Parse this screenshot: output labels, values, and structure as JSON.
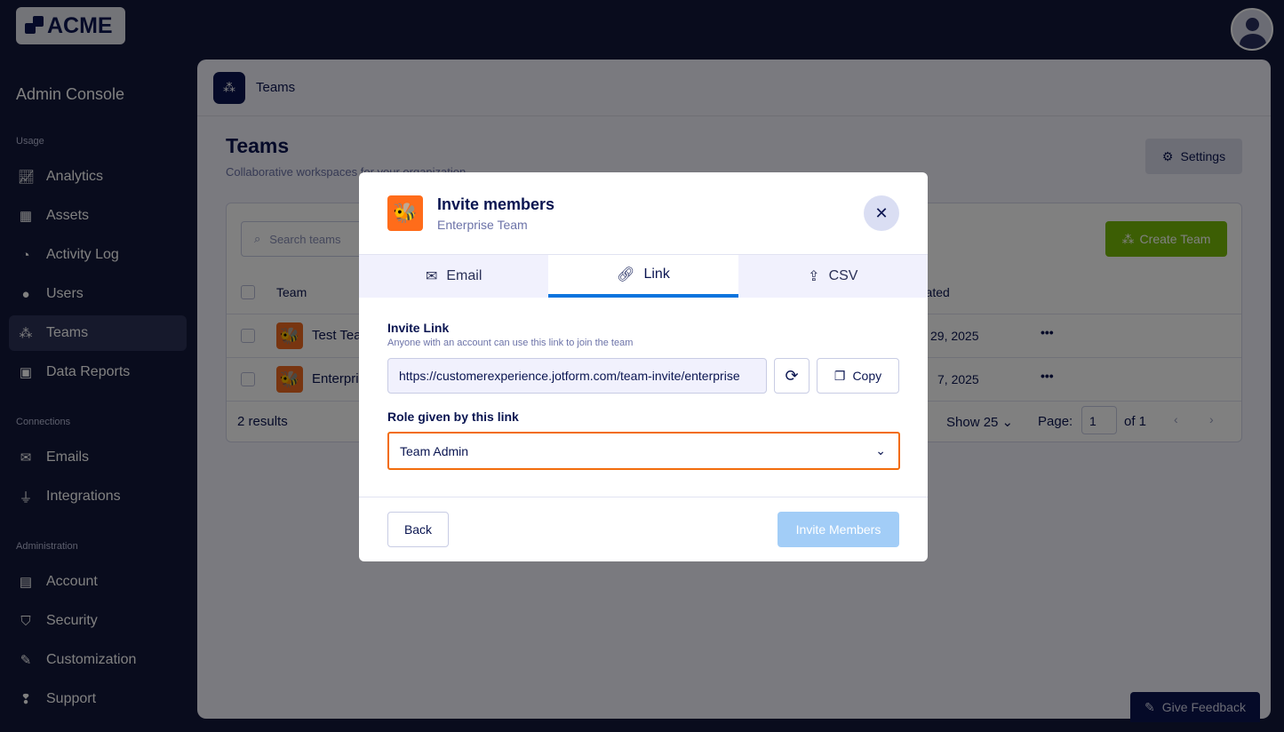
{
  "brand": {
    "logo_text": "ACME"
  },
  "sidebar": {
    "title": "Admin Console",
    "sections": [
      {
        "label": "Usage",
        "items": [
          {
            "label": "Analytics",
            "icon": "chart-line-icon"
          },
          {
            "label": "Assets",
            "icon": "assets-icon"
          },
          {
            "label": "Activity Log",
            "icon": "history-icon"
          },
          {
            "label": "Users",
            "icon": "users-icon"
          },
          {
            "label": "Teams",
            "icon": "teams-icon",
            "active": true
          },
          {
            "label": "Data Reports",
            "icon": "report-icon"
          }
        ]
      },
      {
        "label": "Connections",
        "items": [
          {
            "label": "Emails",
            "icon": "mail-icon"
          },
          {
            "label": "Integrations",
            "icon": "plug-icon"
          }
        ]
      },
      {
        "label": "Administration",
        "items": [
          {
            "label": "Account",
            "icon": "account-icon"
          },
          {
            "label": "Security",
            "icon": "shield-icon"
          },
          {
            "label": "Customization",
            "icon": "brush-icon"
          },
          {
            "label": "Support",
            "icon": "support-icon"
          }
        ]
      }
    ]
  },
  "header": {
    "breadcrumb": "Teams"
  },
  "page": {
    "title": "Teams",
    "subtitle": "Collaborative workspaces for your organization",
    "settings_label": "Settings",
    "search_placeholder": "Search teams",
    "create_label": "Create Team",
    "columns": {
      "team": "Team",
      "created": "Created"
    },
    "rows": [
      {
        "name": "Test Team",
        "date": "29, 2025"
      },
      {
        "name": "Enterprise Team",
        "date": "7, 2025"
      }
    ],
    "results": "2 results",
    "show": "Show 25",
    "page_label": "Page:",
    "page_value": "1",
    "page_of": "of 1"
  },
  "modal": {
    "title": "Invite members",
    "subtitle": "Enterprise Team",
    "tabs": [
      {
        "label": "Email"
      },
      {
        "label": "Link",
        "active": true
      },
      {
        "label": "CSV"
      }
    ],
    "invite_link_label": "Invite Link",
    "invite_link_hint": "Anyone with an account can use this link to join the team",
    "invite_link_value": "https://customerexperience.jotform.com/team-invite/enterprise",
    "copy_label": "Copy",
    "role_label": "Role given by this link",
    "role_value": "Team Admin",
    "back_label": "Back",
    "invite_label": "Invite Members"
  },
  "feedback_label": "Give Feedback",
  "colors": {
    "accent": "#0b74de",
    "focus": "#f26c0c",
    "create": "#78bb07"
  }
}
